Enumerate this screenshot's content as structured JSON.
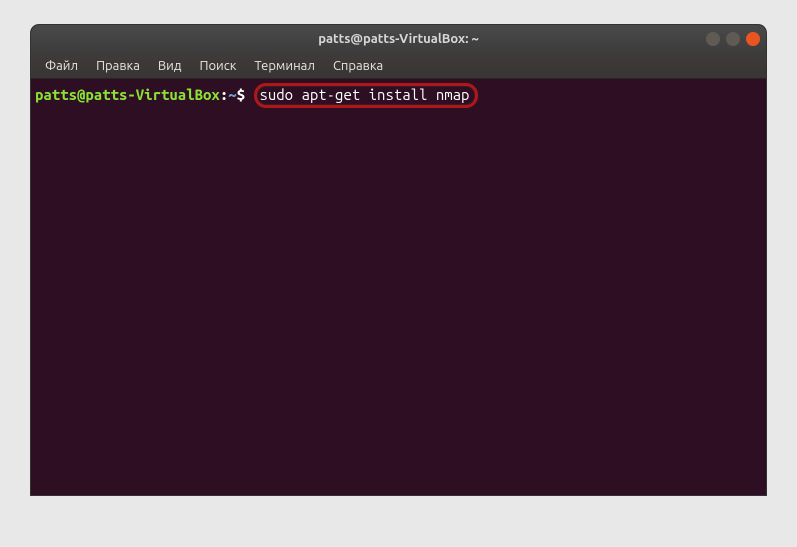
{
  "window": {
    "title": "patts@patts-VirtualBox: ~"
  },
  "menu": {
    "items": [
      "Файл",
      "Правка",
      "Вид",
      "Поиск",
      "Терминал",
      "Справка"
    ]
  },
  "terminal": {
    "prompt": {
      "user_host": "patts@patts-VirtualBox",
      "separator": ":",
      "cwd": "~",
      "sigil": "$"
    },
    "command": "sudo apt-get install nmap"
  }
}
